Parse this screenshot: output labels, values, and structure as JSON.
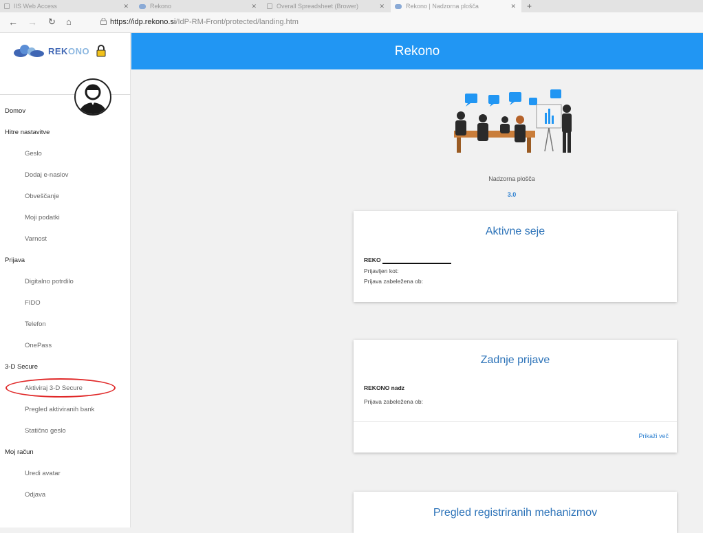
{
  "browser": {
    "tabs": [
      {
        "label": "IIS Web Access",
        "active": false
      },
      {
        "label": "Rekono",
        "active": false
      },
      {
        "label": "Overall Spreadsheet (Brower)",
        "active": false
      },
      {
        "label": "Rekono | Nadzorna plošča",
        "active": true
      }
    ],
    "url_host": "https://idp.rekono.si",
    "url_path": "/IdP-RM-Front/protected/landing.htm"
  },
  "sidebar": {
    "logo_text_a": "REK",
    "logo_text_b": "ONO",
    "items": [
      {
        "label": "Domov",
        "type": "head"
      },
      {
        "label": "Hitre nastavitve",
        "type": "head"
      },
      {
        "label": "Geslo",
        "type": "sub"
      },
      {
        "label": "Dodaj e-naslov",
        "type": "sub"
      },
      {
        "label": "Obveščanje",
        "type": "sub"
      },
      {
        "label": "Moji podatki",
        "type": "sub"
      },
      {
        "label": "Varnost",
        "type": "sub"
      },
      {
        "label": "Prijava",
        "type": "head"
      },
      {
        "label": "Digitalno potrdilo",
        "type": "sub"
      },
      {
        "label": "FIDO",
        "type": "sub"
      },
      {
        "label": "Telefon",
        "type": "sub"
      },
      {
        "label": "OnePass",
        "type": "sub"
      },
      {
        "label": "3-D Secure",
        "type": "head"
      },
      {
        "label": "Aktiviraj 3-D Secure",
        "type": "sub"
      },
      {
        "label": "Pregled aktiviranih bank",
        "type": "sub"
      },
      {
        "label": "Statično geslo",
        "type": "sub"
      },
      {
        "label": "Moj račun",
        "type": "head"
      },
      {
        "label": "Uredi avatar",
        "type": "sub"
      },
      {
        "label": "Odjava",
        "type": "sub"
      }
    ]
  },
  "header": {
    "title": "Rekono"
  },
  "dashboard": {
    "label": "Nadzorna plošča",
    "version": "3.0"
  },
  "active_sessions": {
    "title": "Aktivne seje",
    "name": "REKO",
    "logged_in_as": "Prijavljen kot:",
    "logged_at": "Prijava zabeležena ob:"
  },
  "last_logins": {
    "title": "Zadnje prijave",
    "name": "REKONO nadz",
    "logged_at": "Prijava zabeležena ob:",
    "more": "Prikaži več"
  },
  "mechanisms": {
    "title": "Pregled registriranih mehanizmov"
  },
  "colors": {
    "header": "#2196f3",
    "accent": "#2b72b8",
    "highlight": "#e02828"
  }
}
